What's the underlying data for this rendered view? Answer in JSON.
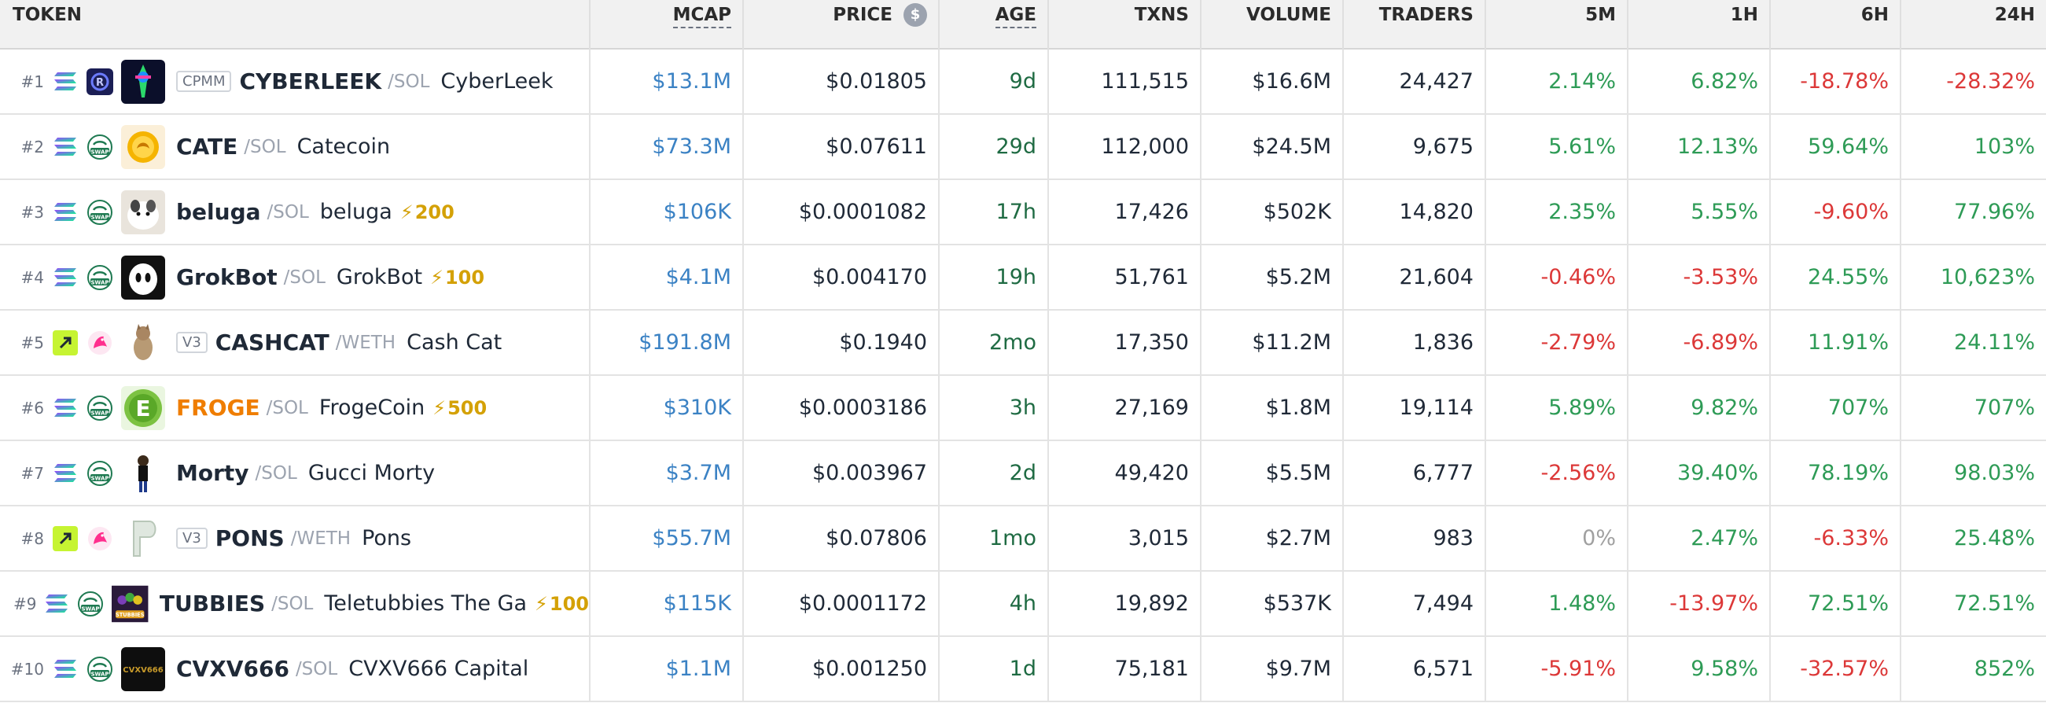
{
  "headers": {
    "token": "TOKEN",
    "mcap": "MCAP",
    "price": "PRICE",
    "price_icon": "$",
    "age": "AGE",
    "txns": "TXNS",
    "volume": "VOLUME",
    "traders": "TRADERS",
    "m5": "5M",
    "h1": "1H",
    "h6": "6H",
    "h24": "24H"
  },
  "colors": {
    "positive": "#2e9b56",
    "negative": "#dc3838",
    "mcap_link": "#3b82c4",
    "boost": "#d4a106",
    "header_bg": "#f1f1f1"
  },
  "rows": [
    {
      "rank": "#1",
      "chain_icon": "solana-icon",
      "dex_icon": "raydium-icon",
      "avatar_icon": "cyberleek-avatar",
      "badge": "CPMM",
      "symbol": "CYBERLEEK",
      "pair": "/SOL",
      "name": "CyberLeek",
      "boost": "",
      "mcap": "$13.1M",
      "price": "$0.01805",
      "age": "9d",
      "txns": "111,515",
      "volume": "$16.6M",
      "traders": "24,427",
      "m5": "2.14%",
      "h1": "6.82%",
      "h6": "-18.78%",
      "h24": "-28.32%"
    },
    {
      "rank": "#2",
      "chain_icon": "solana-icon",
      "dex_icon": "swap-icon",
      "avatar_icon": "catecoin-avatar",
      "badge": "",
      "symbol": "CATE",
      "pair": "/SOL",
      "name": "Catecoin",
      "boost": "",
      "mcap": "$73.3M",
      "price": "$0.07611",
      "age": "29d",
      "txns": "112,000",
      "volume": "$24.5M",
      "traders": "9,675",
      "m5": "5.61%",
      "h1": "12.13%",
      "h6": "59.64%",
      "h24": "103%"
    },
    {
      "rank": "#3",
      "chain_icon": "solana-icon",
      "dex_icon": "swap-icon",
      "avatar_icon": "beluga-avatar",
      "badge": "",
      "symbol": "beluga",
      "pair": "/SOL",
      "name": "beluga",
      "boost": "200",
      "mcap": "$106K",
      "price": "$0.0001082",
      "age": "17h",
      "txns": "17,426",
      "volume": "$502K",
      "traders": "14,820",
      "m5": "2.35%",
      "h1": "5.55%",
      "h6": "-9.60%",
      "h24": "77.96%"
    },
    {
      "rank": "#4",
      "chain_icon": "solana-icon",
      "dex_icon": "swap-icon",
      "avatar_icon": "grokbot-avatar",
      "badge": "",
      "symbol": "GrokBot",
      "pair": "/SOL",
      "name": "GrokBot",
      "boost": "100",
      "mcap": "$4.1M",
      "price": "$0.004170",
      "age": "19h",
      "txns": "51,761",
      "volume": "$5.2M",
      "traders": "21,604",
      "m5": "-0.46%",
      "h1": "-3.53%",
      "h6": "24.55%",
      "h24": "10,623%"
    },
    {
      "rank": "#5",
      "chain_icon": "base-chain-icon",
      "dex_icon": "uniswap-icon",
      "avatar_icon": "cashcat-avatar",
      "badge": "V3",
      "symbol": "CASHCAT",
      "pair": "/WETH",
      "name": "Cash Cat",
      "boost": "",
      "mcap": "$191.8M",
      "price": "$0.1940",
      "age": "2mo",
      "txns": "17,350",
      "volume": "$11.2M",
      "traders": "1,836",
      "m5": "-2.79%",
      "h1": "-6.89%",
      "h6": "11.91%",
      "h24": "24.11%"
    },
    {
      "rank": "#6",
      "chain_icon": "solana-icon",
      "dex_icon": "swap-icon",
      "avatar_icon": "frogecoin-avatar",
      "badge": "",
      "symbol": "FROGE",
      "pair": "/SOL",
      "name": "FrogeCoin",
      "boost": "500",
      "mcap": "$310K",
      "price": "$0.0003186",
      "age": "3h",
      "txns": "27,169",
      "volume": "$1.8M",
      "traders": "19,114",
      "m5": "5.89%",
      "h1": "9.82%",
      "h6": "707%",
      "h24": "707%"
    },
    {
      "rank": "#7",
      "chain_icon": "solana-icon",
      "dex_icon": "swap-icon",
      "avatar_icon": "morty-avatar",
      "badge": "",
      "symbol": "Morty",
      "pair": "/SOL",
      "name": "Gucci Morty",
      "boost": "",
      "mcap": "$3.7M",
      "price": "$0.003967",
      "age": "2d",
      "txns": "49,420",
      "volume": "$5.5M",
      "traders": "6,777",
      "m5": "-2.56%",
      "h1": "39.40%",
      "h6": "78.19%",
      "h24": "98.03%"
    },
    {
      "rank": "#8",
      "chain_icon": "base-chain-icon",
      "dex_icon": "uniswap-icon",
      "avatar_icon": "pons-avatar",
      "badge": "V3",
      "symbol": "PONS",
      "pair": "/WETH",
      "name": "Pons",
      "boost": "",
      "mcap": "$55.7M",
      "price": "$0.07806",
      "age": "1mo",
      "txns": "3,015",
      "volume": "$2.7M",
      "traders": "983",
      "m5": "0%",
      "h1": "2.47%",
      "h6": "-6.33%",
      "h24": "25.48%"
    },
    {
      "rank": "#9",
      "chain_icon": "solana-icon",
      "dex_icon": "swap-icon",
      "avatar_icon": "tubbies-avatar",
      "badge": "",
      "symbol": "TUBBIES",
      "pair": "/SOL",
      "name": "Teletubbies The Ga",
      "boost": "100",
      "mcap": "$115K",
      "price": "$0.0001172",
      "age": "4h",
      "txns": "19,892",
      "volume": "$537K",
      "traders": "7,494",
      "m5": "1.48%",
      "h1": "-13.97%",
      "h6": "72.51%",
      "h24": "72.51%"
    },
    {
      "rank": "#10",
      "chain_icon": "solana-icon",
      "dex_icon": "swap-icon",
      "avatar_icon": "cvxv666-avatar",
      "badge": "",
      "symbol": "CVXV666",
      "pair": "/SOL",
      "name": "CVXV666 Capital",
      "boost": "",
      "mcap": "$1.1M",
      "price": "$0.001250",
      "age": "1d",
      "txns": "75,181",
      "volume": "$9.7M",
      "traders": "6,571",
      "m5": "-5.91%",
      "h1": "9.58%",
      "h6": "-32.57%",
      "h24": "852%"
    }
  ]
}
